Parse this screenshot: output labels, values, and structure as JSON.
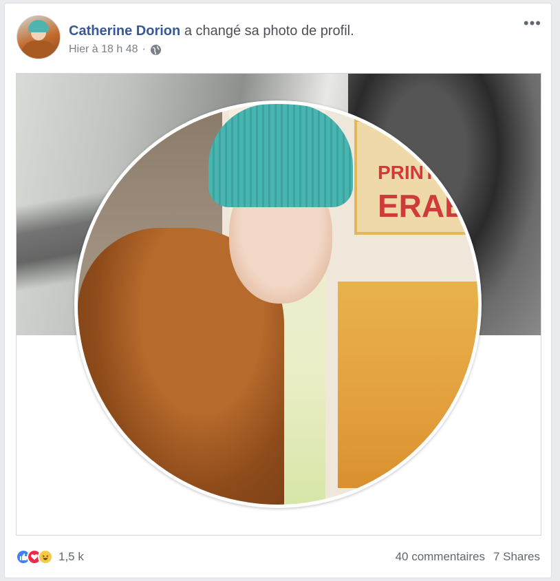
{
  "post": {
    "author": "Catherine Dorion",
    "action": "a changé sa photo de profil.",
    "timestamp": "Hier à 18 h 48",
    "separator": "·",
    "privacy_icon": "globe-icon",
    "menu_icon": "more-options-icon",
    "menu_label": "•••"
  },
  "poster_text": {
    "line1": "PRINT",
    "line2": "ERABL"
  },
  "footer": {
    "reactions": [
      "like",
      "love",
      "haha"
    ],
    "reaction_count": "1,5 k",
    "comments": "40 commentaires",
    "shares": "7 Shares"
  },
  "colors": {
    "author_link": "#385898",
    "like": "#3b82f6",
    "love": "#f0284a",
    "haha": "#f7c948"
  }
}
